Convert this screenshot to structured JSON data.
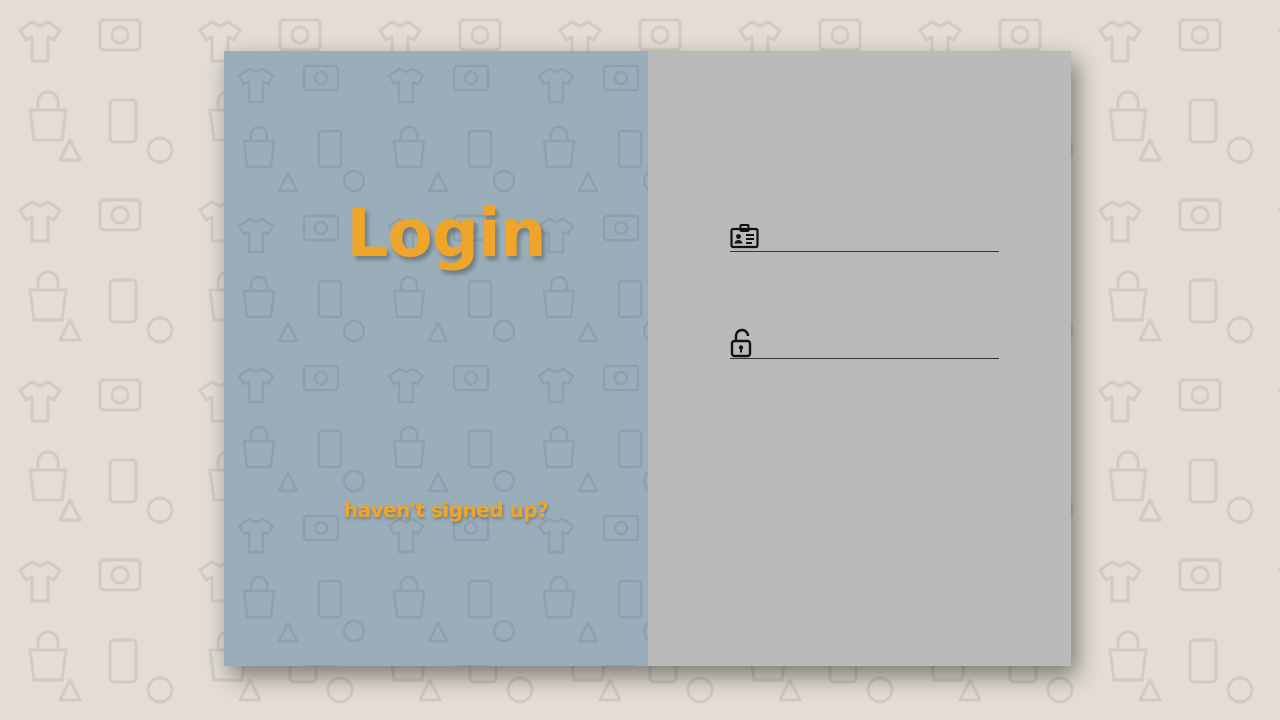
{
  "login": {
    "title": "Login",
    "signup_link": "haven't signed up?",
    "username": {
      "icon": "id-card-icon",
      "value": "",
      "placeholder": ""
    },
    "password": {
      "icon": "unlock-icon",
      "value": "",
      "placeholder": ""
    }
  },
  "colors": {
    "page_background": "#e3ddd4",
    "left_panel": "#9aaeba",
    "right_panel": "#bababa",
    "accent": "#eea52a"
  }
}
